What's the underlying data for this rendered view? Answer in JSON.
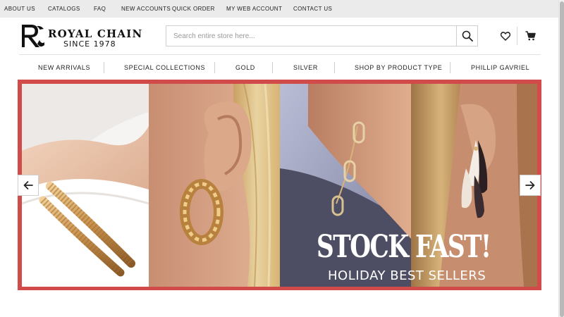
{
  "topbar": {
    "links": [
      "ABOUT US",
      "CATALOGS",
      "FAQ",
      "NEW ACCOUNTS",
      "QUICK ORDER",
      "MY WEB ACCOUNT",
      "CONTACT US"
    ]
  },
  "logo": {
    "brand": "ROYAL CHAIN",
    "since": "SINCE 1978",
    "monogram": "RC"
  },
  "search": {
    "placeholder": "Search entire store here...",
    "value": ""
  },
  "icons": {
    "search": "search-icon",
    "wishlist": "heart-icon",
    "cart": "cart-icon",
    "prev": "arrow-left-icon",
    "next": "arrow-right-icon"
  },
  "nav": {
    "items": [
      "NEW ARRIVALS",
      "SPECIAL COLLECTIONS",
      "GOLD",
      "SILVER",
      "SHOP BY PRODUCT TYPE",
      "PHILLIP GAVRIEL"
    ]
  },
  "hero": {
    "headline": "STOCK FAST!",
    "subheadline": "HOLIDAY BEST SELLERS"
  },
  "colors": {
    "banner_border": "#d24b4b",
    "topbar_bg": "#ebebeb"
  }
}
